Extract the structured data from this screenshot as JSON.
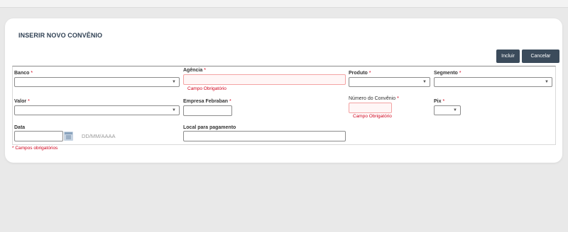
{
  "page": {
    "title": "INSERIR NOVO CONVÊNIO"
  },
  "actions": {
    "incluir": "Incluir",
    "cancelar": "Cancelar"
  },
  "fields": {
    "banco": {
      "label": "Banco",
      "required": "*"
    },
    "agencia": {
      "label": "Agência",
      "required": "*",
      "error": "Campo Obrigatório"
    },
    "produto": {
      "label": "Produto",
      "required": "*"
    },
    "segmento": {
      "label": "Segmento",
      "required": "*"
    },
    "valor": {
      "label": "Valor",
      "required": "*"
    },
    "empresa_febraban": {
      "label": "Empresa Febraban",
      "required": "*"
    },
    "numero_convenio": {
      "label": "Número do Convênio",
      "required": "*",
      "error": "Campo Obrigatório"
    },
    "pix": {
      "label": "Pix",
      "required": "*"
    },
    "data": {
      "label": "Data",
      "hint": "DD/MM/AAAA"
    },
    "local_pagamento": {
      "label": "Local para pagamento"
    }
  },
  "footer": {
    "required_note": "* Campos obrigatórios"
  },
  "icons": {
    "dropdown": "chevron-down-icon",
    "calendar": "calendar-icon"
  },
  "colors": {
    "button": "#3b4b5b",
    "error": "#d0021b",
    "title": "#2e3f52"
  }
}
